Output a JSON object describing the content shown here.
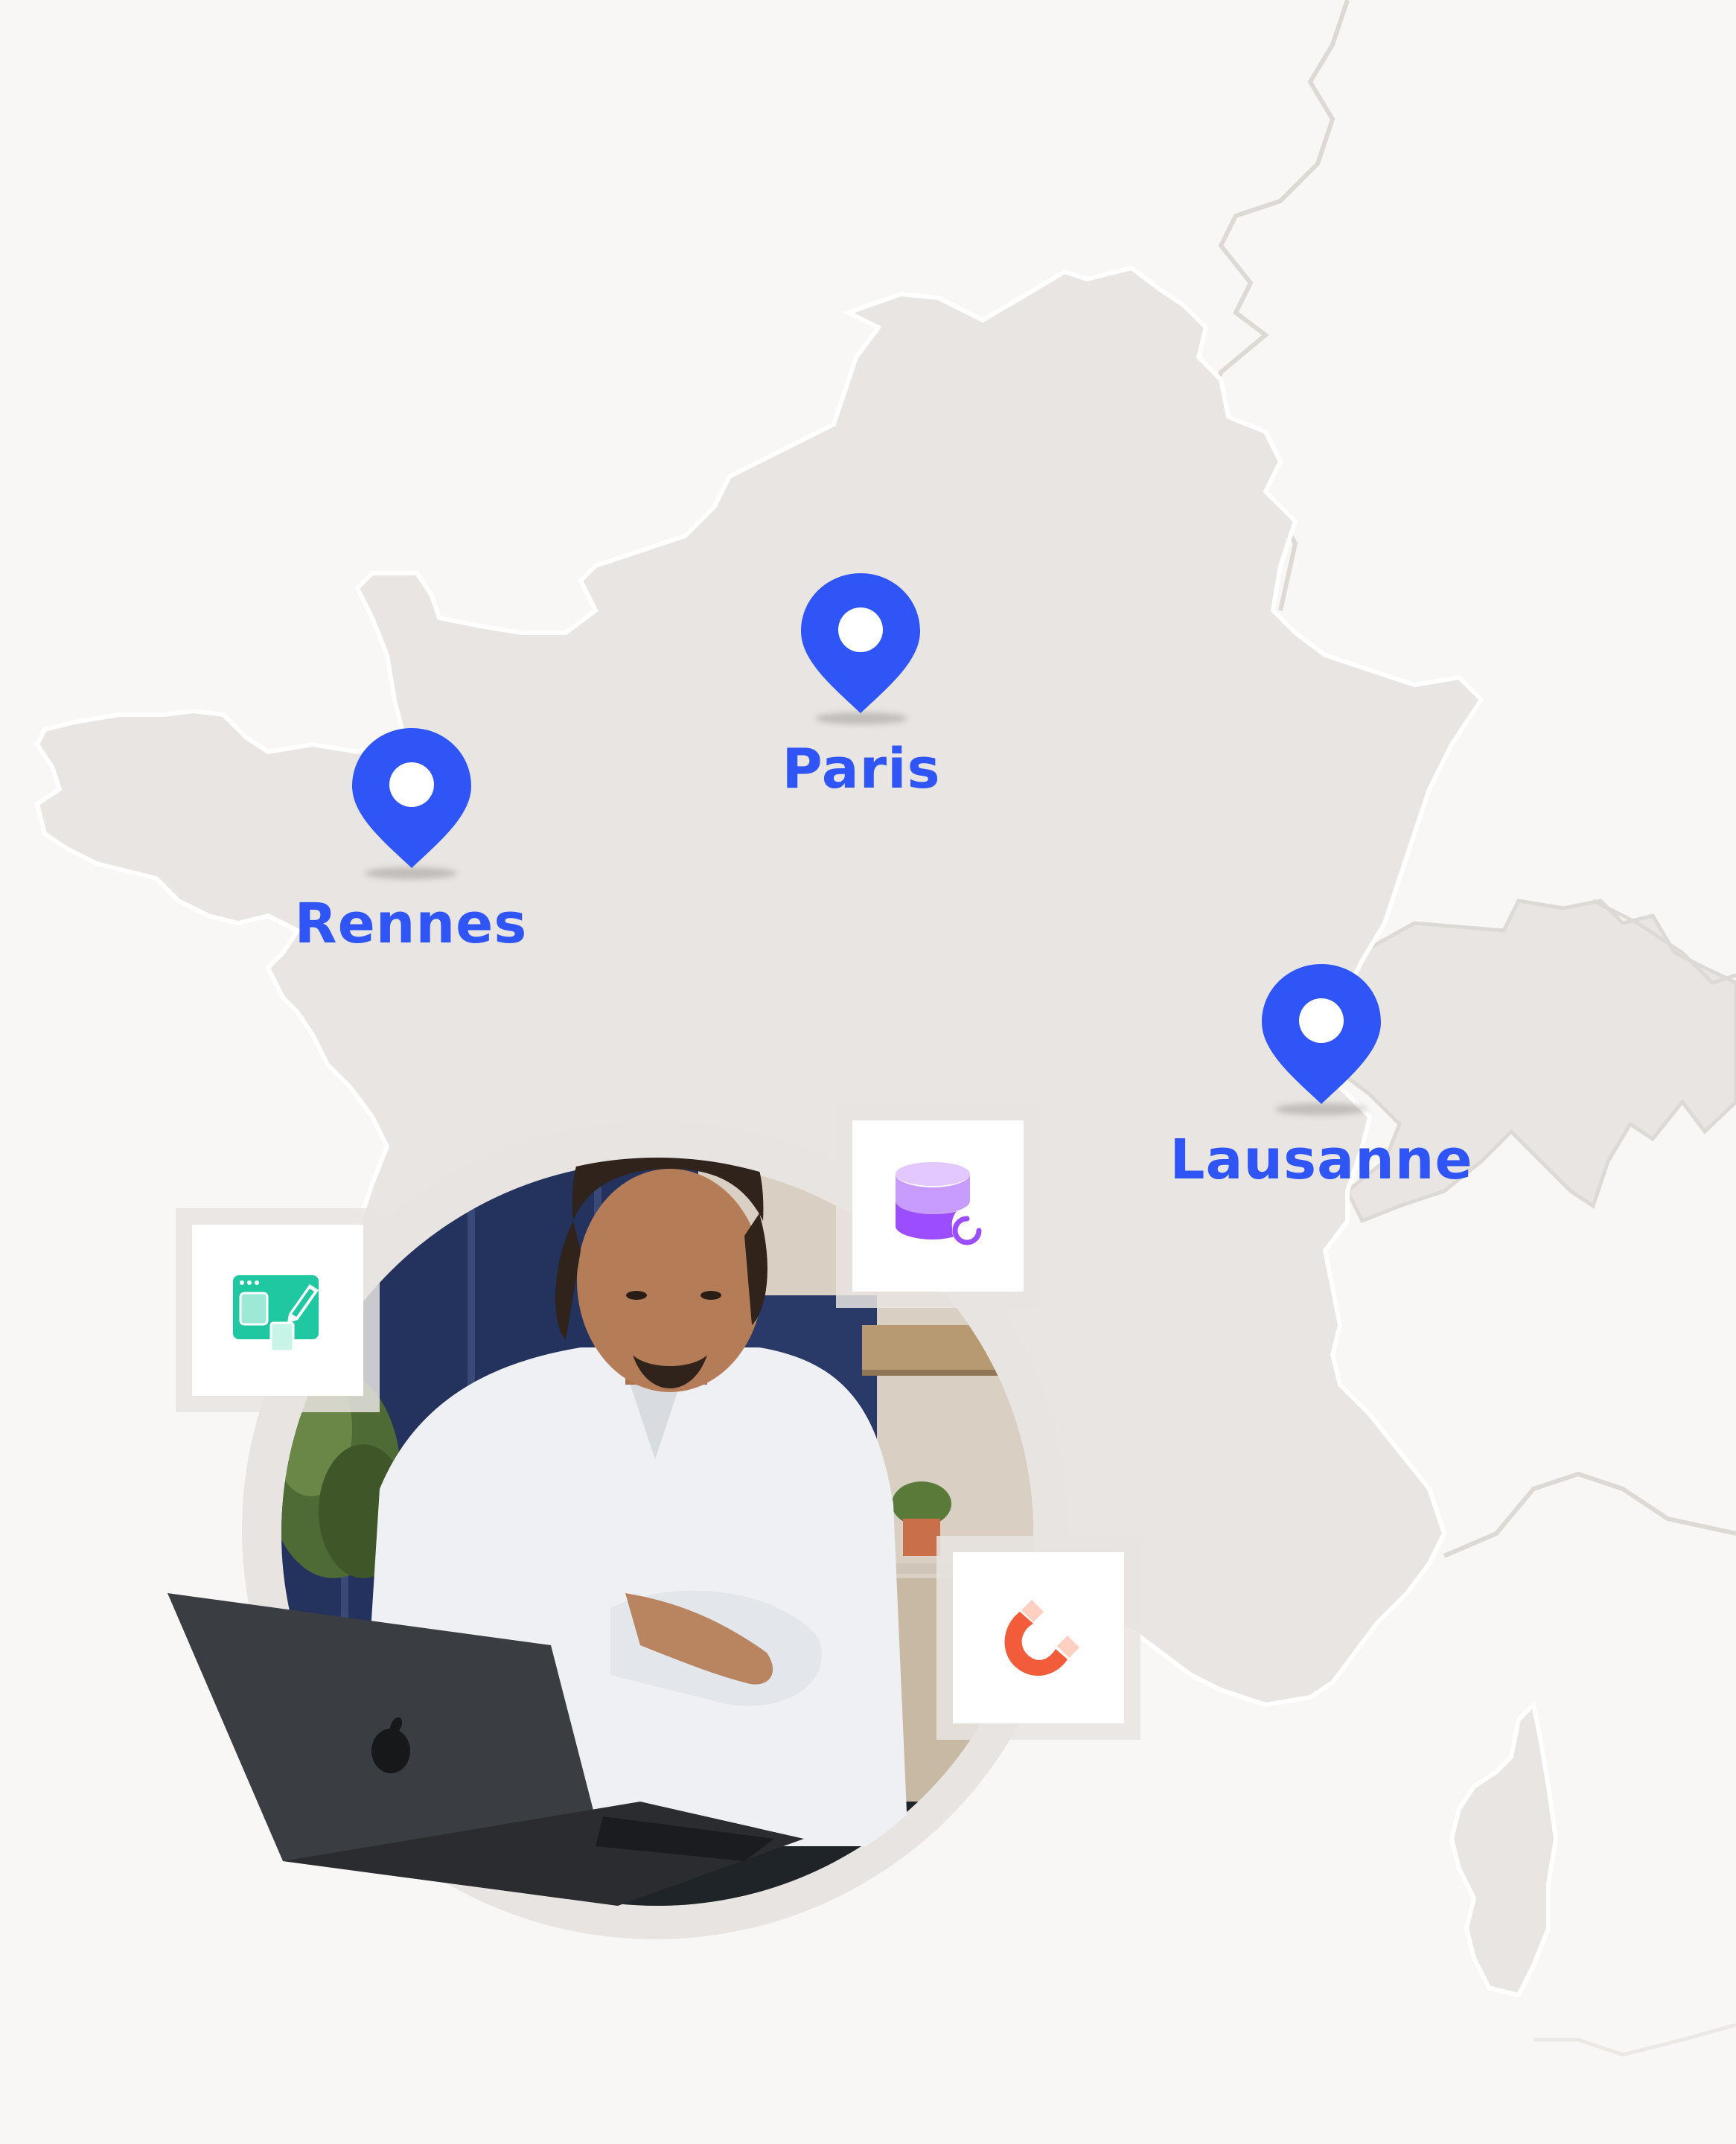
{
  "map": {
    "region": "France",
    "land_color": "#e8e5e2",
    "border_color": "#ffffff",
    "background_color": "#f8f7f6",
    "pin_color": "#2f55f7",
    "locations": [
      {
        "id": "rennes",
        "label": "Rennes"
      },
      {
        "id": "paris",
        "label": "Paris"
      },
      {
        "id": "lausanne",
        "label": "Lausanne"
      }
    ]
  },
  "photo": {
    "subject": "person working on a laptop",
    "icons": [
      "laptop-logo-icon"
    ]
  },
  "app_tiles": [
    {
      "id": "prototyping",
      "icon": "screen-edit-icon",
      "color": "#1fc8a0"
    },
    {
      "id": "database",
      "icon": "database-sync-icon",
      "color": "#9b4dff"
    },
    {
      "id": "magnet",
      "icon": "magnet-icon",
      "color": "#f25c3a"
    }
  ]
}
